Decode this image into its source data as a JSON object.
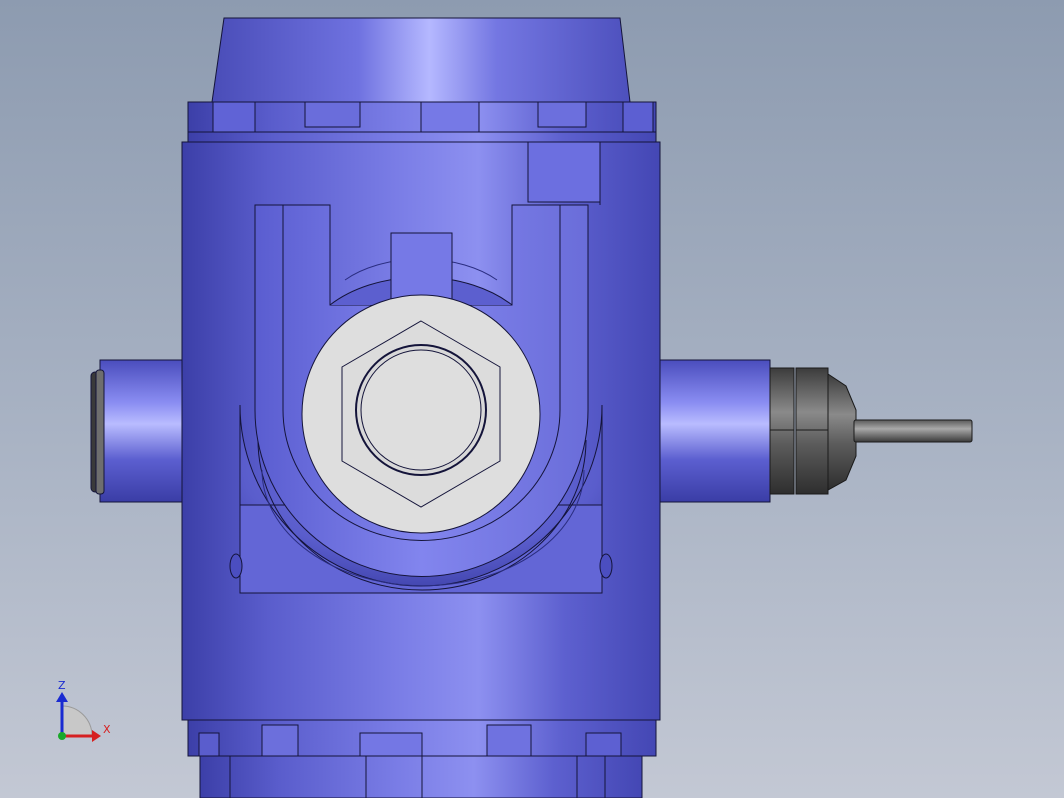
{
  "viewport": {
    "background_top": "#8d9bb0",
    "background_bottom": "#c3c8d4"
  },
  "model": {
    "body_color": "#6b6fd8",
    "edge_color": "#14143a",
    "fitting_face_color": "#dedede",
    "gland_color": "#5a5a5a",
    "probe_color": "#6e6e6e"
  },
  "triad": {
    "z_label": "Z",
    "x_label": "X",
    "z_color": "#1a2bd1",
    "x_color": "#d62020",
    "y_color": "#19a82a"
  }
}
